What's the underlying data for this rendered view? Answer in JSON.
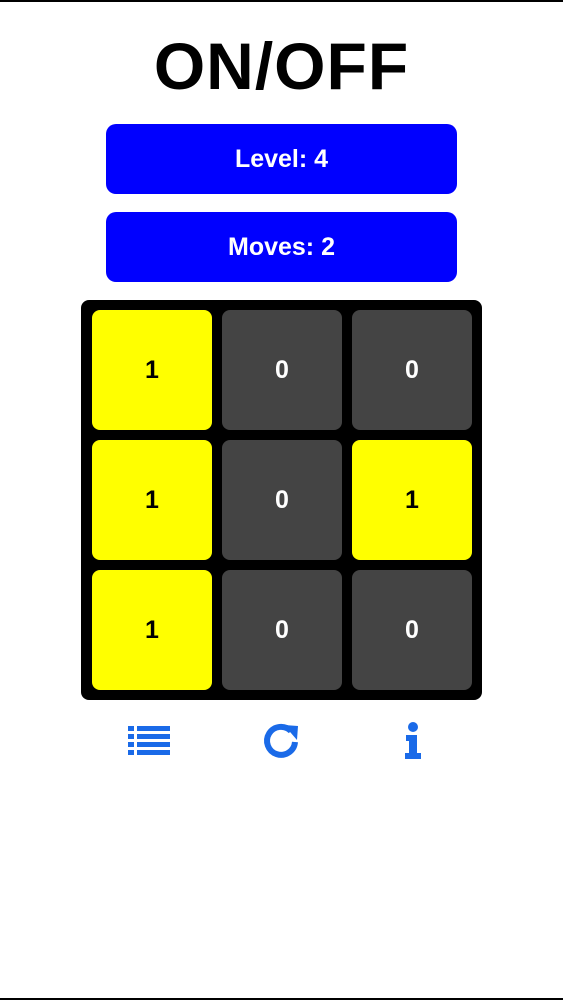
{
  "title": "ON/OFF",
  "level": {
    "label": "Level: 4"
  },
  "moves": {
    "label": "Moves: 2"
  },
  "board": {
    "rows": [
      [
        {
          "value": "1",
          "state": "on"
        },
        {
          "value": "0",
          "state": "off"
        },
        {
          "value": "0",
          "state": "off"
        }
      ],
      [
        {
          "value": "1",
          "state": "on"
        },
        {
          "value": "0",
          "state": "off"
        },
        {
          "value": "1",
          "state": "on"
        }
      ],
      [
        {
          "value": "1",
          "state": "on"
        },
        {
          "value": "0",
          "state": "off"
        },
        {
          "value": "0",
          "state": "off"
        }
      ]
    ]
  },
  "toolbar": {
    "buttons": [
      {
        "icon": "list-icon"
      },
      {
        "icon": "refresh-icon"
      },
      {
        "icon": "info-icon"
      }
    ]
  },
  "colors": {
    "accent": "#0000ff",
    "icon": "#1a6ae8",
    "cell_on": "#ffff00",
    "cell_off": "#444444",
    "board": "#000000"
  }
}
